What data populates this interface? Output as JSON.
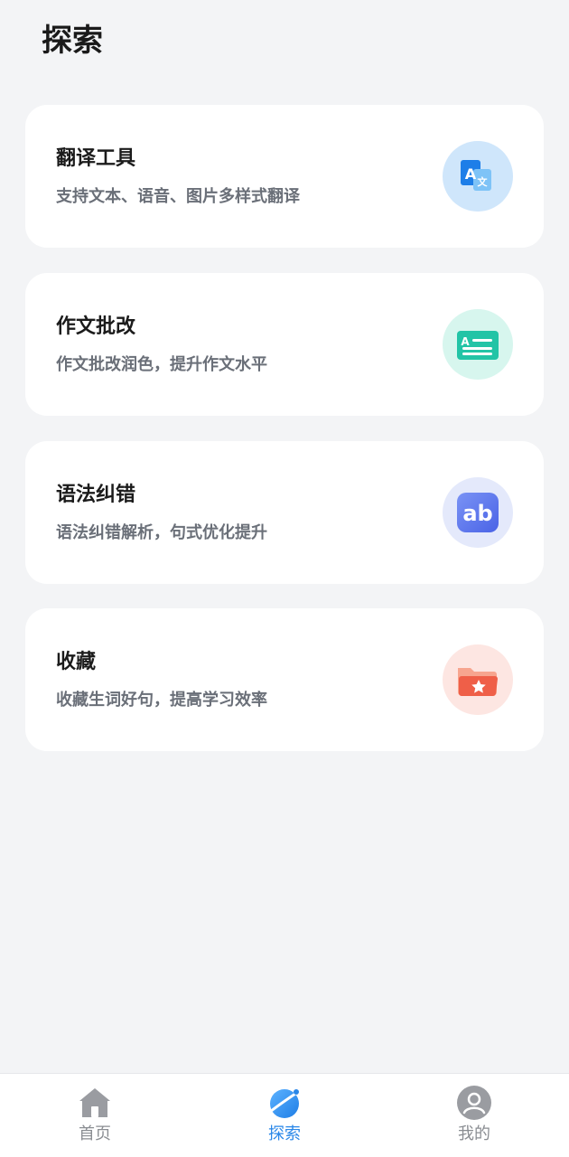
{
  "page": {
    "title": "探索"
  },
  "cards": [
    {
      "title": "翻译工具",
      "desc": "支持文本、语音、图片多样式翻译",
      "icon": "translate-icon"
    },
    {
      "title": "作文批改",
      "desc": "作文批改润色，提升作文水平",
      "icon": "essay-icon"
    },
    {
      "title": "语法纠错",
      "desc": "语法纠错解析，句式优化提升",
      "icon": "grammar-icon"
    },
    {
      "title": "收藏",
      "desc": "收藏生词好句，提高学习效率",
      "icon": "folder-star-icon"
    }
  ],
  "icons": {
    "translate": {
      "letter_a": "A",
      "letter_wen": "文"
    },
    "essay": {
      "letter_a": "A"
    },
    "grammar": {
      "text": "ab"
    }
  },
  "tabbar": {
    "tabs": [
      {
        "label": "首页",
        "icon": "home-icon",
        "active": false
      },
      {
        "label": "探索",
        "icon": "planet-icon",
        "active": true
      },
      {
        "label": "我的",
        "icon": "profile-icon",
        "active": false
      }
    ]
  },
  "colors": {
    "background": "#f3f4f6",
    "accent": "#2a87e8",
    "inactive": "#8a8d92"
  }
}
